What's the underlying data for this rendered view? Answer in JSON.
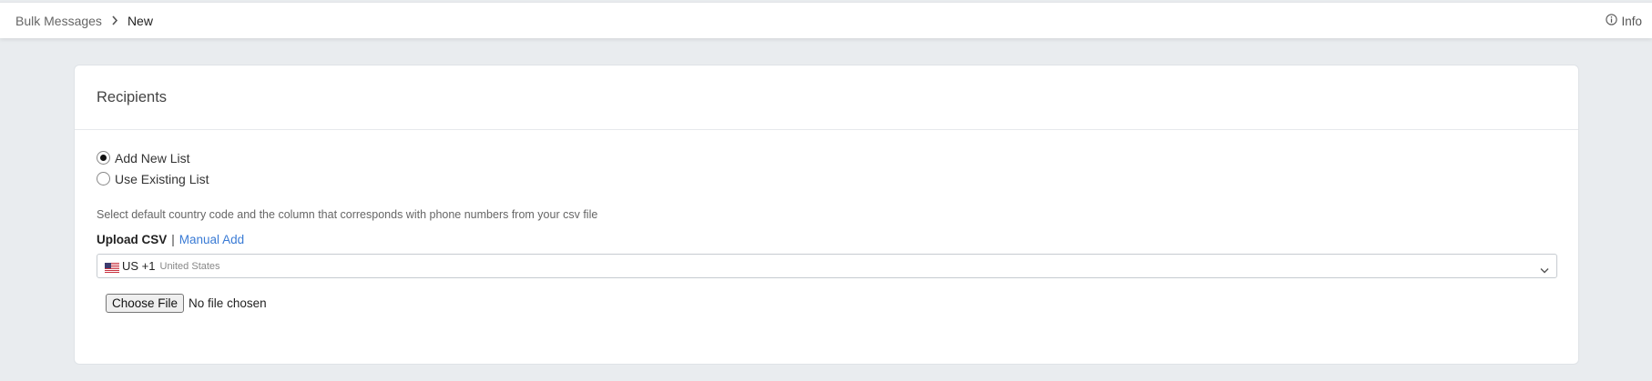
{
  "breadcrumb": {
    "parent": "Bulk Messages",
    "current": "New"
  },
  "info": {
    "label": "Info"
  },
  "recipients": {
    "title": "Recipients",
    "options": [
      {
        "label": "Add New List",
        "checked": true
      },
      {
        "label": "Use Existing List",
        "checked": false
      }
    ],
    "hint": "Select default country code and the column that corresponds with phone numbers from your csv file",
    "mode": {
      "active": "Upload CSV",
      "separator": "|",
      "alternate": "Manual Add"
    },
    "country": {
      "code": "US +1",
      "name": "United States",
      "flag_icon": "us-flag-icon"
    },
    "file": {
      "button_label": "Choose File",
      "status": "No file chosen"
    }
  },
  "colors": {
    "page_background": "#e9ecef",
    "link": "#3a7bd5",
    "card_background": "#ffffff"
  }
}
